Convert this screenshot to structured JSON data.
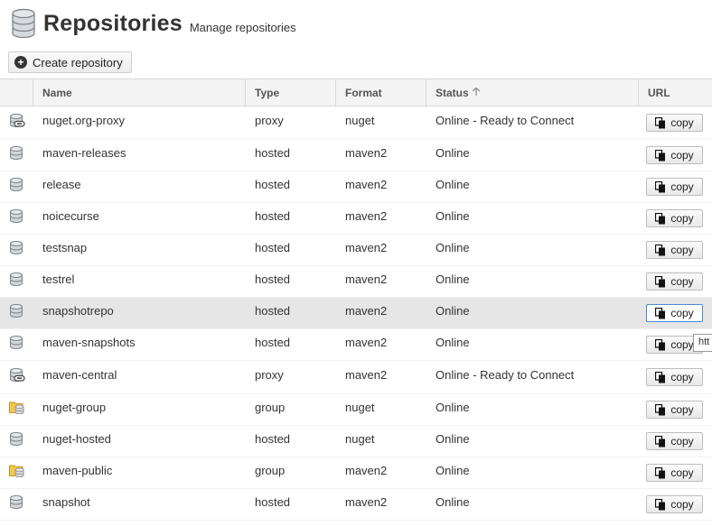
{
  "header": {
    "title": "Repositories",
    "subtitle": "Manage repositories",
    "icon": "database-icon"
  },
  "toolbar": {
    "create_label": "Create repository"
  },
  "columns": {
    "name": "Name",
    "type": "Type",
    "format": "Format",
    "status": "Status",
    "url": "URL"
  },
  "copy_label": "copy",
  "tooltip": "htt",
  "rows": [
    {
      "name": "nuget.org-proxy",
      "type": "proxy",
      "format": "nuget",
      "status": "Online - Ready to Connect",
      "icon": "proxy-repository-icon"
    },
    {
      "name": "maven-releases",
      "type": "hosted",
      "format": "maven2",
      "status": "Online",
      "icon": "hosted-repository-icon"
    },
    {
      "name": "release",
      "type": "hosted",
      "format": "maven2",
      "status": "Online",
      "icon": "hosted-repository-icon"
    },
    {
      "name": "noicecurse",
      "type": "hosted",
      "format": "maven2",
      "status": "Online",
      "icon": "hosted-repository-icon"
    },
    {
      "name": "testsnap",
      "type": "hosted",
      "format": "maven2",
      "status": "Online",
      "icon": "hosted-repository-icon"
    },
    {
      "name": "testrel",
      "type": "hosted",
      "format": "maven2",
      "status": "Online",
      "icon": "hosted-repository-icon"
    },
    {
      "name": "snapshotrepo",
      "type": "hosted",
      "format": "maven2",
      "status": "Online",
      "icon": "hosted-repository-icon"
    },
    {
      "name": "maven-snapshots",
      "type": "hosted",
      "format": "maven2",
      "status": "Online",
      "icon": "hosted-repository-icon"
    },
    {
      "name": "maven-central",
      "type": "proxy",
      "format": "maven2",
      "status": "Online - Ready to Connect",
      "icon": "proxy-repository-icon"
    },
    {
      "name": "nuget-group",
      "type": "group",
      "format": "nuget",
      "status": "Online",
      "icon": "group-repository-icon"
    },
    {
      "name": "nuget-hosted",
      "type": "hosted",
      "format": "nuget",
      "status": "Online",
      "icon": "hosted-repository-icon"
    },
    {
      "name": "maven-public",
      "type": "group",
      "format": "maven2",
      "status": "Online",
      "icon": "group-repository-icon"
    },
    {
      "name": "snapshot",
      "type": "hosted",
      "format": "maven2",
      "status": "Online",
      "icon": "hosted-repository-icon"
    }
  ]
}
